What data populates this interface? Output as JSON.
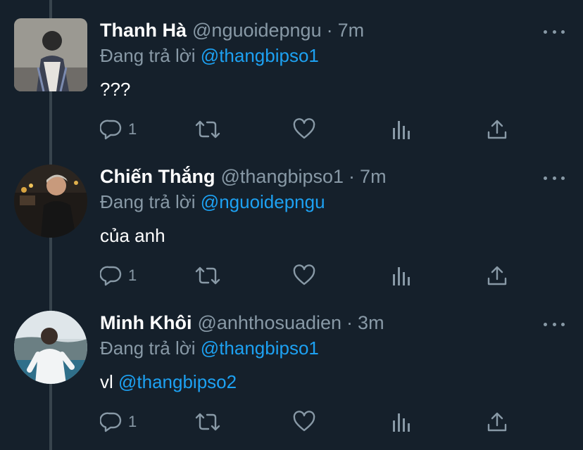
{
  "colors": {
    "background": "#15202b",
    "text_primary": "#ffffff",
    "text_secondary": "#8899a6",
    "accent": "#1da1f2",
    "thread_line": "#38444d"
  },
  "tweets": [
    {
      "name": "Thanh Hà",
      "handle": "@nguoidepngu",
      "separator": "·",
      "time": "7m",
      "reply_prefix": "Đang trả lời",
      "reply_to": "@thangbipso1",
      "text": "???",
      "text_mention": "",
      "reply_count": "1",
      "avatar_icon": "user-photo-avatar"
    },
    {
      "name": "Chiến Thắng",
      "handle": "@thangbipso1",
      "separator": "·",
      "time": "7m",
      "reply_prefix": "Đang trả lời",
      "reply_to": "@nguoidepngu",
      "text": "của anh",
      "text_mention": "",
      "reply_count": "1",
      "avatar_icon": "user-photo-avatar"
    },
    {
      "name": "Minh Khôi",
      "handle": "@anhthosuadien",
      "separator": "·",
      "time": "3m",
      "reply_prefix": "Đang trả lời",
      "reply_to": "@thangbipso1",
      "text": "vl",
      "text_mention": "@thangbipso2",
      "reply_count": "1",
      "avatar_icon": "user-photo-avatar"
    }
  ],
  "icons": [
    "reply-icon",
    "retweet-icon",
    "like-icon",
    "analytics-icon",
    "share-icon",
    "more-icon"
  ]
}
